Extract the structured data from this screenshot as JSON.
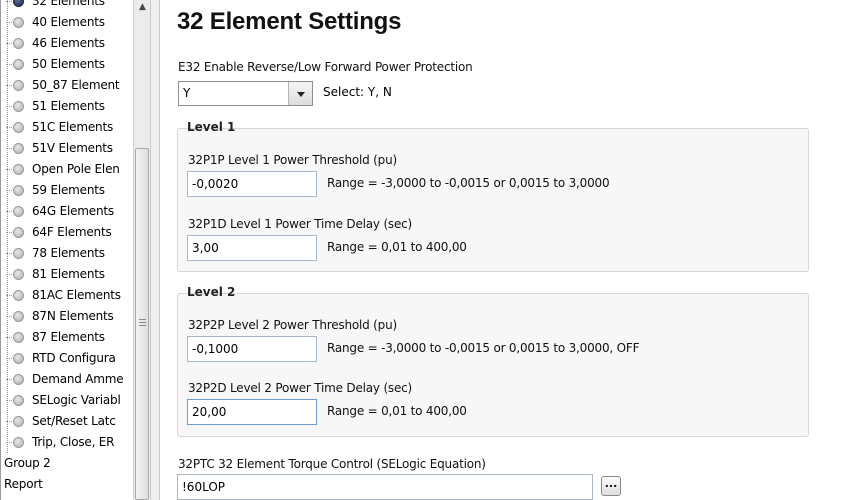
{
  "tree": {
    "items": [
      {
        "label": "32 Elements",
        "selected": true
      },
      {
        "label": "40 Elements"
      },
      {
        "label": "46 Elements"
      },
      {
        "label": "50 Elements"
      },
      {
        "label": "50_87 Element"
      },
      {
        "label": "51 Elements"
      },
      {
        "label": "51C Elements"
      },
      {
        "label": "51V Elements"
      },
      {
        "label": "Open Pole Elen"
      },
      {
        "label": "59 Elements"
      },
      {
        "label": "64G Elements"
      },
      {
        "label": "64F Elements"
      },
      {
        "label": "78 Elements"
      },
      {
        "label": "81 Elements"
      },
      {
        "label": "81AC Elements"
      },
      {
        "label": "87N Elements"
      },
      {
        "label": "87 Elements"
      },
      {
        "label": "RTD Configura"
      },
      {
        "label": "Demand Amme"
      },
      {
        "label": "SELogic Variabl"
      },
      {
        "label": "Set/Reset Latc"
      },
      {
        "label": "Trip, Close, ER"
      }
    ],
    "top_items": [
      {
        "label": "Group 2"
      },
      {
        "label": "Report"
      }
    ]
  },
  "main": {
    "title": "32 Element Settings",
    "e32": {
      "label": "E32  Enable Reverse/Low Forward Power Protection",
      "value": "Y",
      "hint": "Select: Y, N"
    },
    "level1": {
      "title": "Level 1",
      "p1p": {
        "label": "32P1P  Level 1 Power Threshold (pu)",
        "value": "-0,0020",
        "range": "Range = -3,0000 to -0,0015 or 0,0015 to 3,0000"
      },
      "p1d": {
        "label": "32P1D  Level 1 Power Time Delay (sec)",
        "value": "3,00",
        "range": "Range = 0,01 to 400,00"
      }
    },
    "level2": {
      "title": "Level 2",
      "p2p": {
        "label": "32P2P  Level 2 Power Threshold (pu)",
        "value": "-0,1000",
        "range": "Range = -3,0000 to -0,0015 or 0,0015 to 3,0000, OFF"
      },
      "p2d": {
        "label": "32P2D  Level 2 Power Time Delay (sec)",
        "value": "20,00",
        "range": "Range = 0,01 to 400,00"
      }
    },
    "ptc": {
      "label": "32PTC  32 Element Torque Control (SELogic Equation)",
      "value": "!60LOP",
      "button": "..."
    }
  }
}
